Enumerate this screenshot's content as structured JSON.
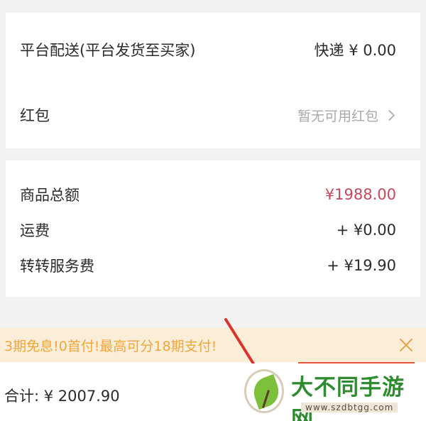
{
  "delivery": {
    "label": "平台配送(平台发货至买家)",
    "value": "快递 ¥ 0.00"
  },
  "red_packet": {
    "label": "红包",
    "value": "暂无可用红包"
  },
  "amounts": {
    "goods_total_label": "商品总额",
    "goods_total_value": "¥1988.00",
    "shipping_label": "运费",
    "shipping_value": "+ ¥0.00",
    "service_fee_label": "转转服务费",
    "service_fee_value": "+ ¥19.90"
  },
  "promo": {
    "text": "3期免息!0首付!最高可分18期支付!"
  },
  "footer": {
    "sum": "合计: ¥ 2007.90"
  },
  "watermark": {
    "title": "大不同手游网",
    "url": "www.szdbtgg.com"
  },
  "icons": {
    "chevron": "chevron-right-icon",
    "close": "close-icon",
    "annotation": "red-arrow-annotation"
  },
  "colors": {
    "price_accent": "#c34a5a",
    "promo_background": "#fbeed9",
    "promo_text": "#f0a63a",
    "arrow": "#d9342b",
    "watermark_green": "#2e8b2f"
  }
}
